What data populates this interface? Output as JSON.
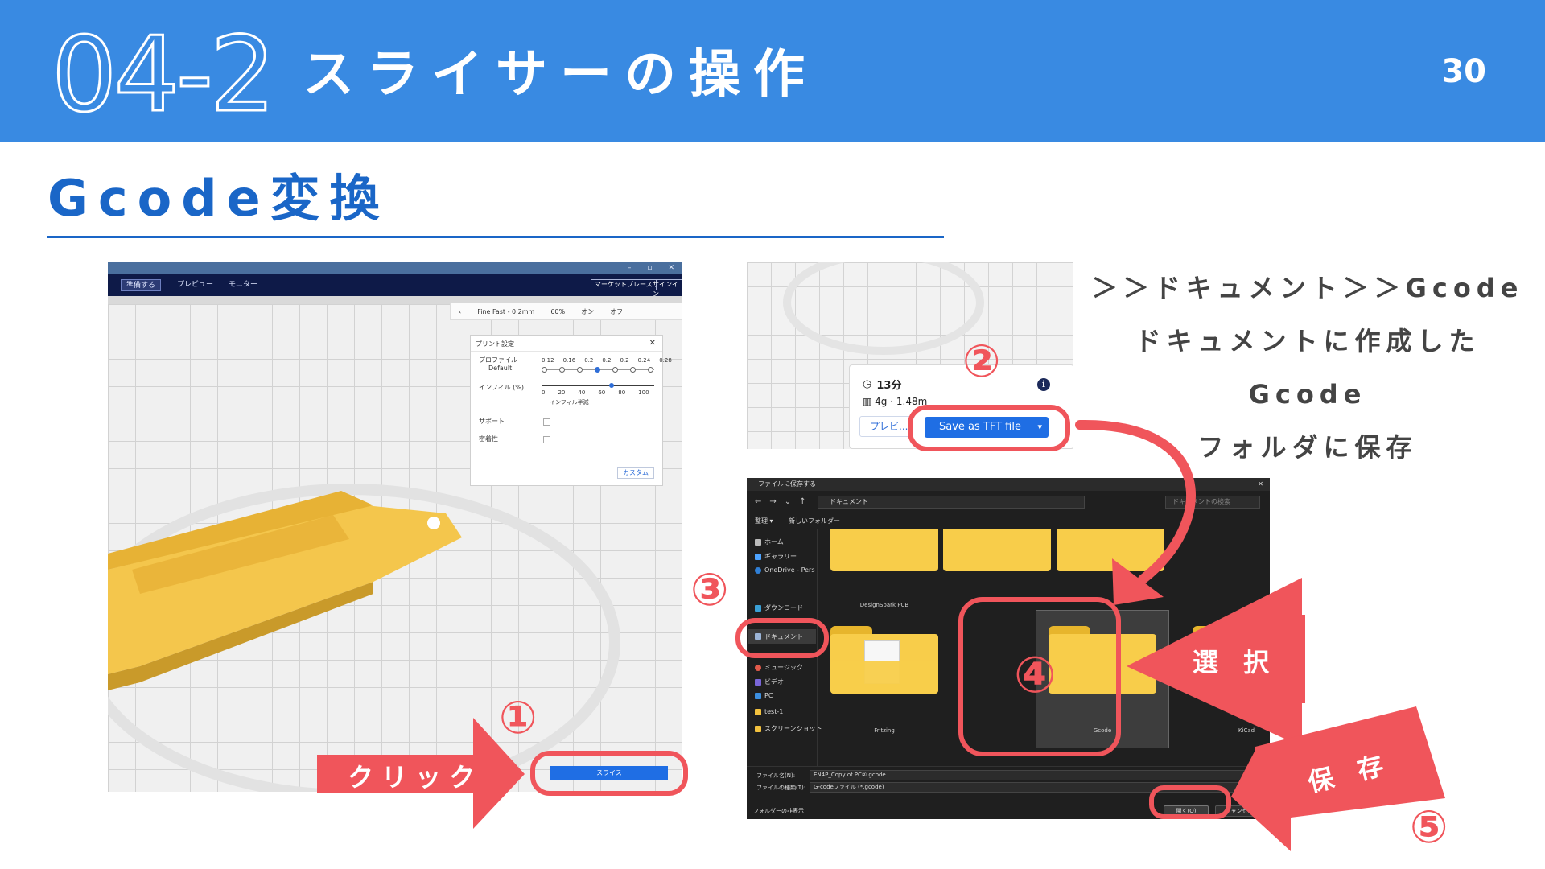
{
  "header": {
    "section_number": "04-2",
    "title": "スライサーの操作",
    "page_number": "30"
  },
  "subtitle": "Gcode変換",
  "notes": [
    "＞＞ドキュメント＞＞Gcode",
    "ドキュメントに作成したGcode",
    "フォルダに保存"
  ],
  "slicer": {
    "nav_tabs": [
      "準備する",
      "プレビュー",
      "モニター"
    ],
    "nav_buttons": [
      "マーケットプレース",
      "サインイン"
    ],
    "window_buttons": [
      "–",
      "▫",
      "✕"
    ],
    "toolbar": {
      "back": "‹",
      "profile": "Fine Fast - 0.2mm",
      "infill": "60%",
      "support": "オン",
      "adhesion": "オフ"
    },
    "print_panel": {
      "title": "プリント設定",
      "profile_label": "プロファイル",
      "profile_value": "Default",
      "layer_ticks": [
        "0.12",
        "0.16",
        "0.2",
        "0.2",
        "0.2",
        "0.24",
        "0.28"
      ],
      "infill_label": "インフィル (%)",
      "infill_ticks": [
        "0",
        "20",
        "40",
        "60",
        "80",
        "100"
      ],
      "infill_gradual": "インフィル半減",
      "support_label": "サポート",
      "adhesion_label": "密着性",
      "custom_button": "カスタム"
    },
    "slice_button": "スライス"
  },
  "save_panel": {
    "time": "13分",
    "weight": "4g · 1.48m",
    "preview_button": "プレビ...",
    "save_button": "Save as TFT file"
  },
  "dialog": {
    "title": "ファイルに保存する",
    "path": "ドキュメント",
    "search_placeholder": "ドキュメントの検索",
    "organize": "整理 ▾",
    "new_folder": "新しいフォルダー",
    "sidebar": [
      "ホーム",
      "ギャラリー",
      "OneDrive - Pers",
      "ダウンロード",
      "ドキュメント",
      "ミュージック",
      "ビデオ",
      "PC",
      "test-1",
      "スクリーンショット"
    ],
    "folders": [
      "DesignSpark PCB",
      "Fritzing",
      "Gcode",
      "KiCad"
    ],
    "filename_label": "ファイル名(N):",
    "filename_value": "EN4P_Copy of PC②.gcode",
    "filetype_label": "ファイルの種類(T):",
    "filetype_value": "G-codeファイル (*.gcode)",
    "hide_folders": "フォルダーの非表示",
    "open_button": "開く(O)",
    "cancel_button": "キャンセル"
  },
  "steps": [
    "①",
    "②",
    "③",
    "④",
    "⑤"
  ],
  "arrows": {
    "click": "クリック",
    "select": "選 択",
    "save": "保 存"
  },
  "colors": {
    "header": "#398ae2",
    "accent_blue": "#1a66c7",
    "highlight": "#f0555b"
  }
}
